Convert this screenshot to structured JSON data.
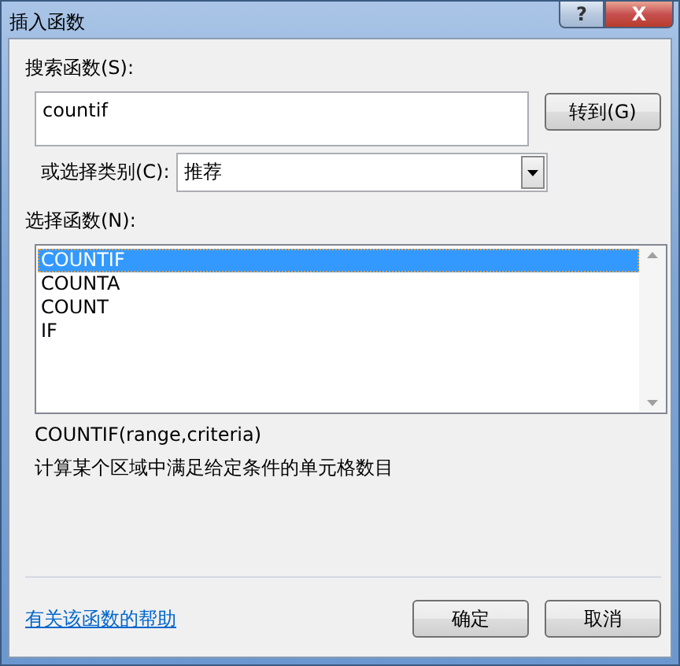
{
  "window": {
    "title": "插入函数",
    "title_buttons": [
      {
        "kind": "help",
        "label": "?"
      },
      {
        "kind": "close",
        "label": "X"
      }
    ]
  },
  "search": {
    "label": "搜索函数(S):",
    "value": "countif",
    "go_button": "转到(G)"
  },
  "category": {
    "label": "或选择类别(C):",
    "value": "推荐"
  },
  "functions": {
    "label": "选择函数(N):",
    "items": [
      {
        "name": "COUNTIF",
        "selected": true
      },
      {
        "name": "COUNTA",
        "selected": false
      },
      {
        "name": "COUNT",
        "selected": false
      },
      {
        "name": "IF",
        "selected": false
      }
    ]
  },
  "signature": "COUNTIF(range,criteria)",
  "description": "计算某个区域中满足给定条件的单元格数目",
  "help_link": "有关该函数的帮助",
  "buttons": [
    "确定",
    "取消"
  ]
}
